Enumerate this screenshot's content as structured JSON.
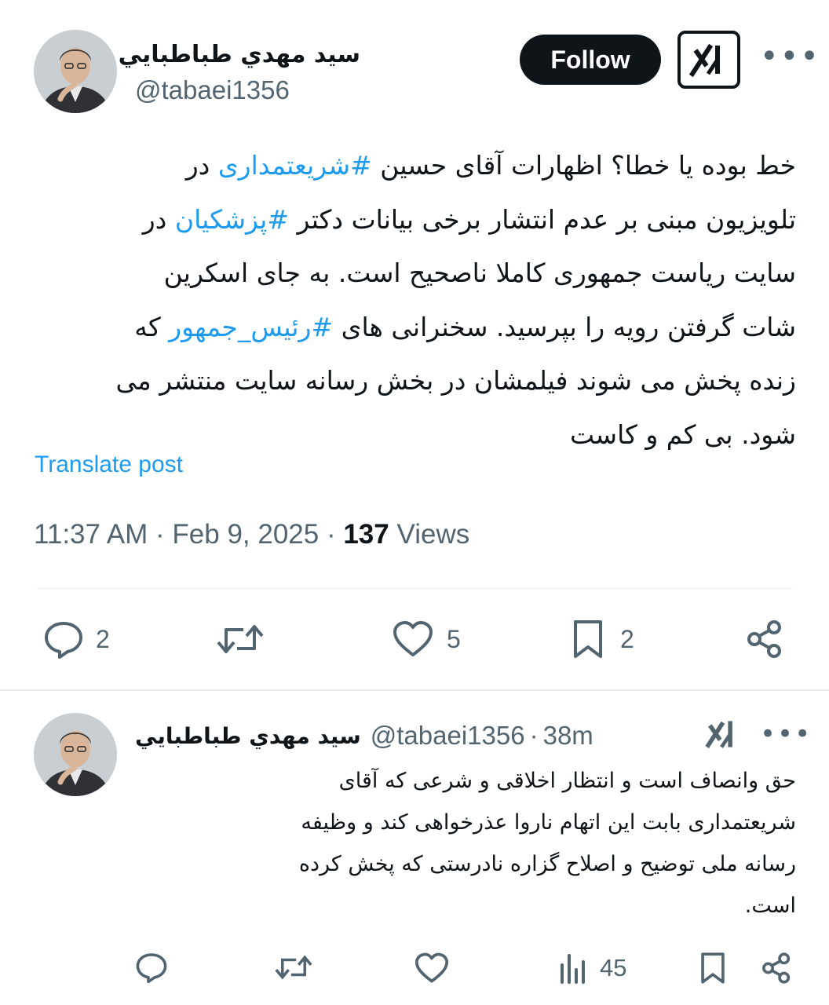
{
  "tweet": {
    "author_name": "سيد مهدي طباطبايي",
    "author_handle": "@tabaei1356",
    "follow_label": "Follow",
    "body_lines": [
      [
        "خط بوده یا خطا؟ اظهارات آقای حسین ",
        "#شریعتمداری",
        " در"
      ],
      [
        "تلویزیون مبنی بر عدم انتشار برخی بیانات دکتر ",
        "#پزشکیان",
        " در"
      ],
      [
        "سایت ریاست جمهوری کاملا ناصحیح است. به جای اسکرین",
        "",
        ""
      ],
      [
        "شات گرفتن رویه را بپرسید. سخنرانی های ",
        "#رئیس_جمهور",
        " که"
      ],
      [
        "زنده پخش می شوند فیلمشان در بخش رسانه سایت منتشر می",
        "",
        ""
      ],
      [
        "شود. بی کم و کاست",
        "",
        ""
      ]
    ],
    "translate_label": "Translate post",
    "time": "11:37 AM",
    "date": "Feb 9, 2025",
    "views_count": "137",
    "views_label": "Views",
    "reply_count": "2",
    "like_count": "5",
    "bookmark_count": "2"
  },
  "reply": {
    "author_name": "سيد مهدي طباطبايي",
    "author_handle": "@tabaei1356",
    "time_ago": "38m",
    "body_lines": [
      "حق وانصاف است و انتظار اخلاقی و شرعی که آقای",
      "شریعتمداری بابت این اتهام ناروا عذرخواهی کند و وظیفه",
      "رسانه ملی توضیح و اصلاح گزاره نادرستی که پخش کرده",
      "است."
    ],
    "views_count": "45"
  },
  "colors": {
    "accent": "#1d9bf0",
    "text": "#0f1419",
    "secondary": "#536471"
  }
}
